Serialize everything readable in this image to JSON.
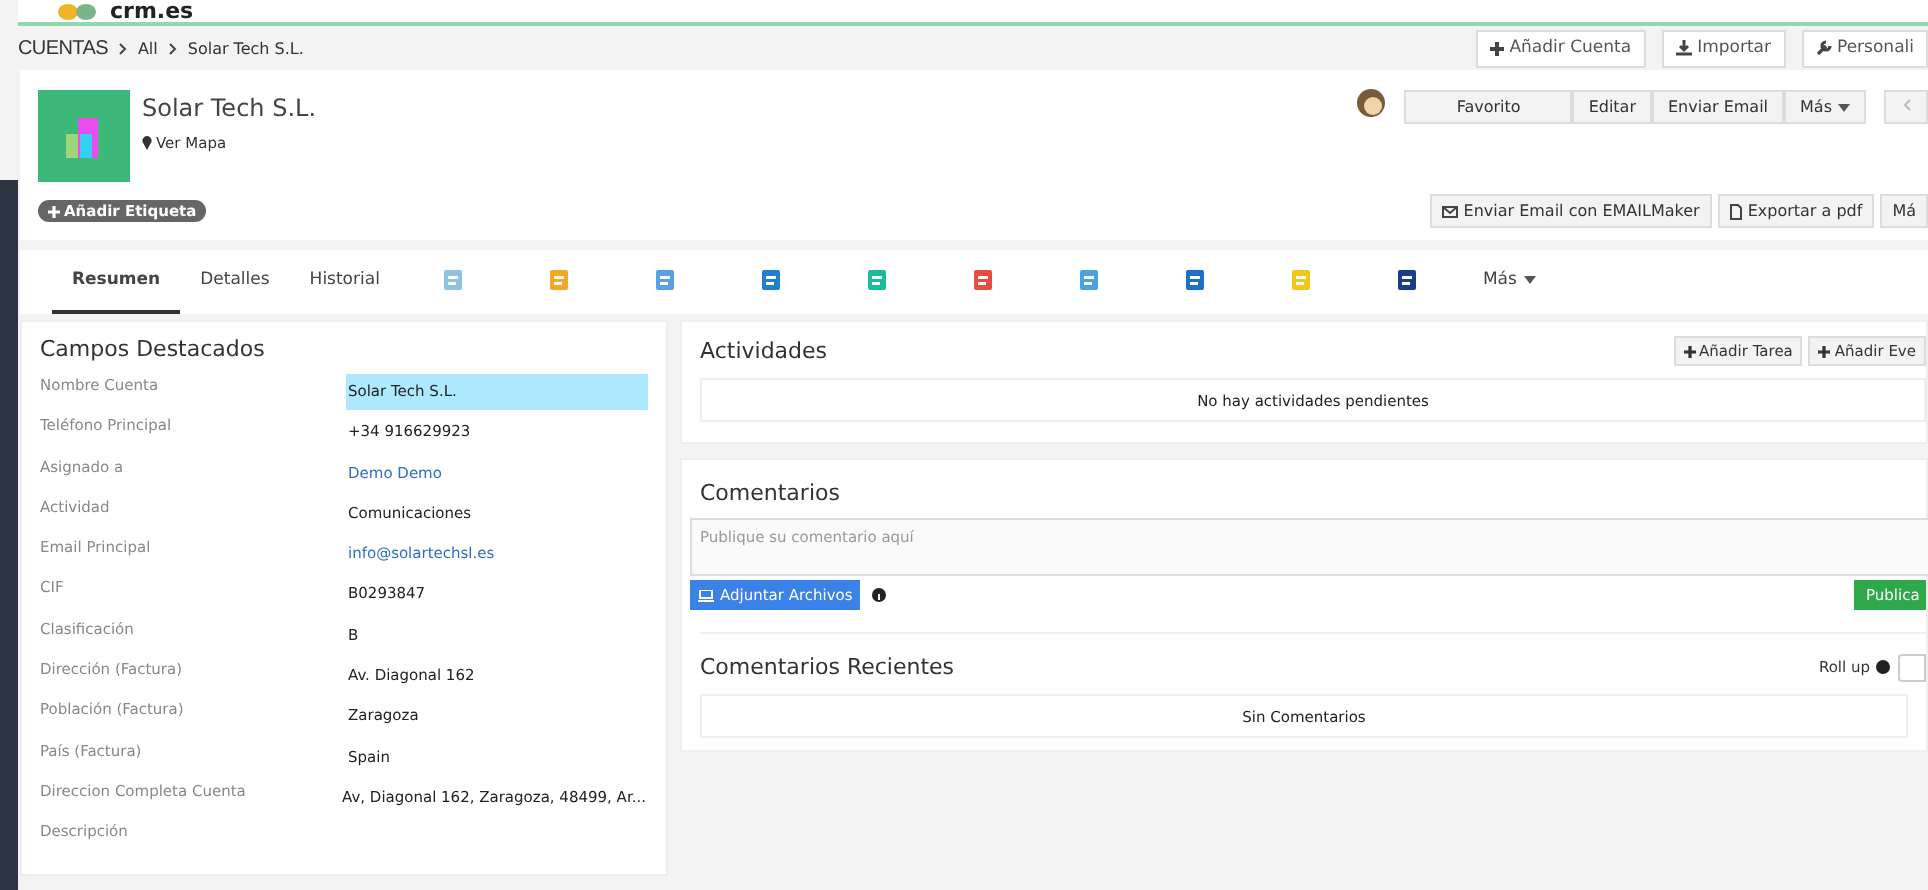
{
  "topbar": {
    "logo": "crm.es"
  },
  "breadcrumb": {
    "module": "CUENTAS",
    "items": [
      "All",
      "Solar Tech S.L."
    ],
    "buttons": [
      {
        "label": "Añadir Cuenta",
        "kind": "plus"
      },
      {
        "label": "Importar",
        "kind": "download"
      },
      {
        "label": "Personali",
        "kind": "wrench"
      }
    ]
  },
  "record": {
    "name": "Solar Tech S.L.",
    "map_link": "Ver Mapa",
    "tag_button": "Añadir Etiqueta",
    "actions": [
      "Favorito",
      "Editar",
      "Enviar Email",
      "Más"
    ],
    "actions2": [
      {
        "label": "Enviar Email con EMAILMaker",
        "kind": "envelope"
      },
      {
        "label": "Exportar a pdf",
        "kind": "pdf"
      },
      {
        "label": "Má",
        "kind": "plain"
      }
    ]
  },
  "tabs": [
    {
      "kind": "text",
      "label": "Resumen",
      "selected": true
    },
    {
      "kind": "text",
      "label": "Detalles",
      "selected": false
    },
    {
      "kind": "text",
      "label": "Historial",
      "selected": false
    },
    {
      "kind": "icon",
      "selected": false
    },
    {
      "kind": "icon",
      "selected": false
    },
    {
      "kind": "icon",
      "selected": false
    },
    {
      "kind": "icon",
      "selected": false
    },
    {
      "kind": "icon",
      "selected": false
    },
    {
      "kind": "icon",
      "selected": false
    },
    {
      "kind": "icon",
      "selected": false
    },
    {
      "kind": "icon",
      "selected": false
    },
    {
      "kind": "icon",
      "selected": false
    },
    {
      "kind": "icon",
      "selected": false
    },
    {
      "kind": "more",
      "label": "Más",
      "selected": false
    }
  ],
  "fields": {
    "title": "Campos Destacados",
    "rows": [
      {
        "label": "Nombre Cuenta",
        "value": "Solar Tech S.L.",
        "kind": "text",
        "selected": true
      },
      {
        "label": "Teléfono Principal",
        "value": "+34 916629923",
        "kind": "text",
        "selected": false
      },
      {
        "label": "Asignado a",
        "value": "Demo Demo",
        "kind": "link",
        "selected": false
      },
      {
        "label": "Actividad",
        "value": "Comunicaciones",
        "kind": "text",
        "selected": false
      },
      {
        "label": "Email Principal",
        "value": "info@solartechsl.es",
        "kind": "link",
        "selected": false
      },
      {
        "label": "CIF",
        "value": "B0293847",
        "kind": "text",
        "selected": false
      },
      {
        "label": "Clasificación",
        "value": "B",
        "kind": "text",
        "selected": false
      },
      {
        "label": "Dirección (Factura)",
        "value": "Av. Diagonal 162",
        "kind": "text",
        "selected": false
      },
      {
        "label": "Población (Factura)",
        "value": "Zaragoza",
        "kind": "text",
        "selected": false
      },
      {
        "label": "País (Factura)",
        "value": "Spain",
        "kind": "text",
        "selected": false
      },
      {
        "label": "Direccion Completa Cuenta",
        "value": "Av, Diagonal 162, Zaragoza, 48499, Ar...",
        "kind": "text",
        "selected": false
      },
      {
        "label": "Descripción"
      }
    ]
  },
  "activities": {
    "title": "Actividades",
    "buttons": [
      "Añadir Tarea",
      "Añadir Eve"
    ],
    "empty": "No hay actividades pendientes"
  },
  "comments": {
    "title": "Comentarios",
    "placeholder": "Publique su comentario aquí",
    "attach": "Adjuntar Archivos",
    "publish": "Publica",
    "recent_title": "Comentarios Recientes",
    "rollup": "Roll up",
    "empty": "Sin Comentarios"
  }
}
